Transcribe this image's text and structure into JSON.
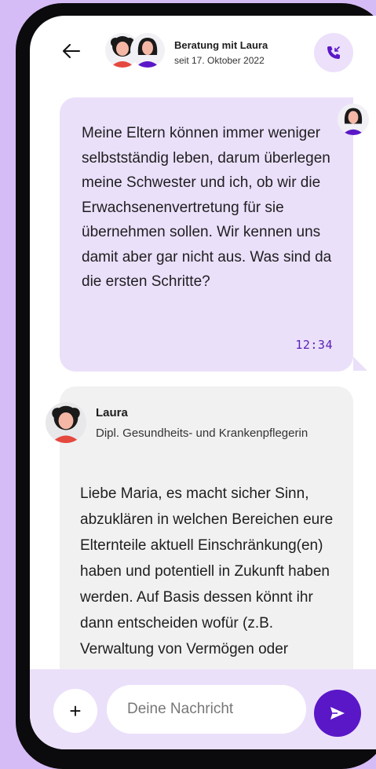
{
  "header": {
    "title": "Beratung mit Laura",
    "subtitle": "seit 17. Oktober 2022",
    "back_icon": "arrow-left-icon",
    "call_icon": "phone-incoming-icon"
  },
  "messages": [
    {
      "direction": "outgoing",
      "text": "Meine Eltern können immer weniger selbstständig leben, darum überlegen meine Schwester und ich, ob wir die Erwachsenenvertretung für sie übernehmen sollen. Wir kennen uns damit aber gar nicht aus. Was sind da die ersten Schritte?",
      "time": "12:34"
    },
    {
      "direction": "incoming",
      "sender": "Laura",
      "role": "Dipl. Gesundheits- und Krankenpflegerin",
      "text": "Liebe Maria,  es macht sicher Sinn, abzuklären in welchen Bereichen eure Elternteile aktuell Einschränkung(en) haben und potentiell in Zukunft haben werden. Auf Basis dessen könnt ihr dann entscheiden wofür (z.B. Verwaltung von Vermögen oder"
    }
  ],
  "composer": {
    "plus_label": "+",
    "placeholder": "Deine Nachricht",
    "send_icon": "send-icon"
  },
  "colors": {
    "background": "#d6bcf6",
    "outgoing_bubble": "#ebe0fa",
    "incoming_bubble": "#f1f1f1",
    "accent": "#5a17c7"
  }
}
